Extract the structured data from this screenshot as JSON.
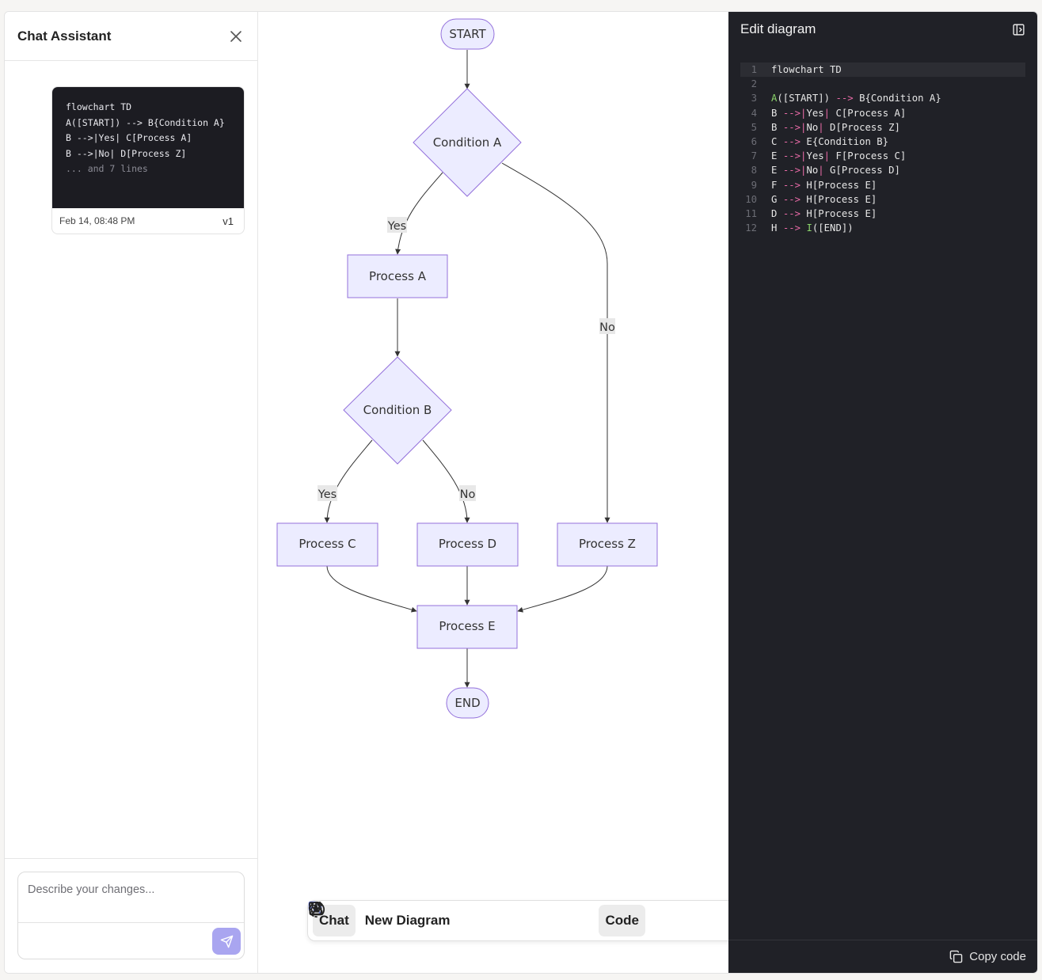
{
  "chat": {
    "title": "Chat Assistant",
    "card": {
      "code_lines": [
        "flowchart TD",
        "",
        "A([START]) --> B{Condition A}",
        "B -->|Yes| C[Process A]",
        "B -->|No| D[Process Z]"
      ],
      "more": "... and 7 lines",
      "date": "Feb 14, 08:48 PM",
      "version": "v1"
    },
    "composer": {
      "placeholder": "Describe your changes..."
    }
  },
  "diagram": {
    "nodes": {
      "start": "START",
      "cond_a": "Condition A",
      "process_a": "Process A",
      "cond_b": "Condition B",
      "process_c": "Process C",
      "process_d": "Process D",
      "process_z": "Process Z",
      "process_e": "Process E",
      "end": "END"
    },
    "edge_labels": {
      "a_yes": "Yes",
      "a_no": "No",
      "b_yes": "Yes",
      "b_no": "No"
    },
    "colors": {
      "fill": "#ececff",
      "stroke": "#9370db",
      "edge": "#333333"
    }
  },
  "toolbar": {
    "chat_label": "Chat",
    "new_diagram_label": "New Diagram",
    "code_label": "Code"
  },
  "editor": {
    "title": "Edit diagram",
    "lines": [
      "flowchart TD",
      "",
      "A([START]) --> B{Condition A}",
      "B -->|Yes| C[Process A]",
      "B -->|No| D[Process Z]",
      "C --> E{Condition B}",
      "E -->|Yes| F[Process C]",
      "E -->|No| G[Process D]",
      "F --> H[Process E]",
      "G --> H[Process E]",
      "D --> H[Process E]",
      "H --> I([END])"
    ],
    "copy_label": "Copy code"
  }
}
